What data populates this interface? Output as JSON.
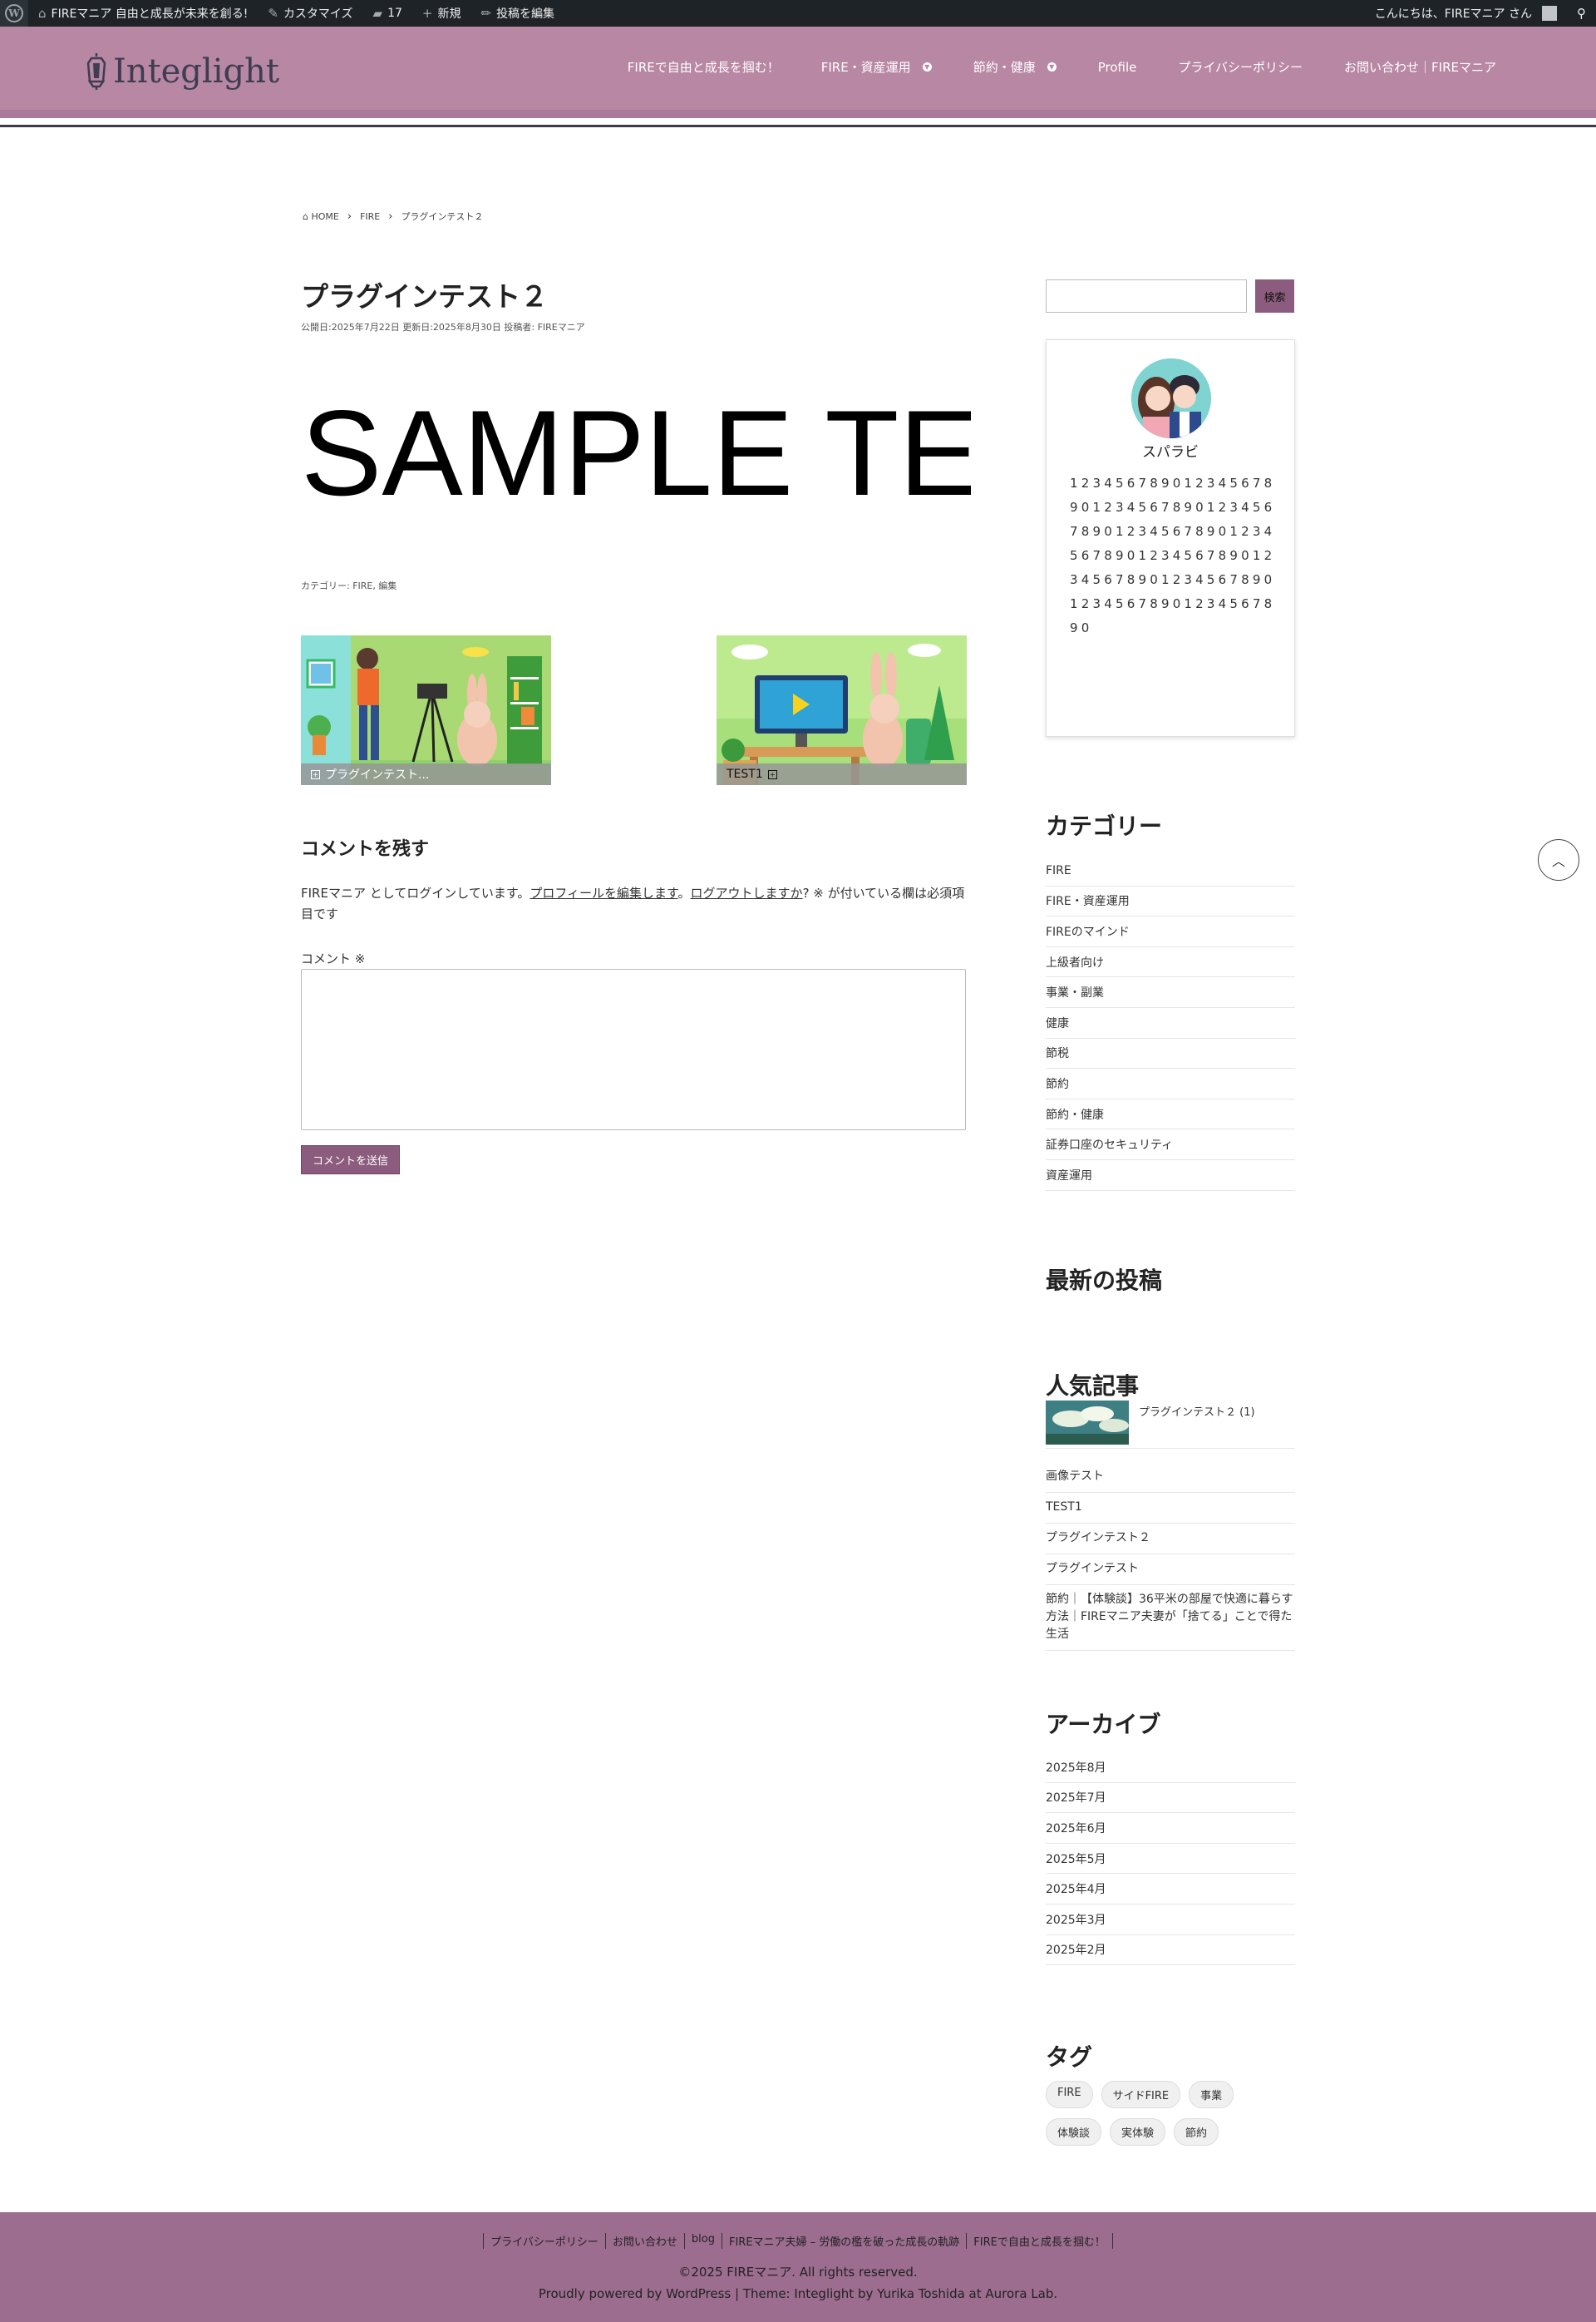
{
  "admin_bar": {
    "site_name": "FIREマニア 自由と成長が未来を創る!",
    "customize": "カスタマイズ",
    "comments_count": "17",
    "new": "新規",
    "edit_post": "投稿を編集",
    "greeting": "こんにちは、FIREマニア さん"
  },
  "header": {
    "logo_text": "Integlight",
    "nav": [
      {
        "label": "FIREで自由と成長を掴む！",
        "has_sub": false
      },
      {
        "label": "FIRE・資産運用",
        "has_sub": true
      },
      {
        "label": "節約・健康",
        "has_sub": true
      },
      {
        "label": "Profile",
        "has_sub": false
      },
      {
        "label": "プライバシーポリシー",
        "has_sub": false
      },
      {
        "label": "お問い合わせ｜FIREマニア",
        "has_sub": false
      }
    ]
  },
  "breadcrumb": {
    "home": "HOME",
    "cat": "FIRE",
    "current": "プラグインテスト２"
  },
  "post": {
    "title": "プラグインテスト２",
    "meta": "公開日:2025年7月22日 更新日:2025年8月30日 投稿者: FIREマニア",
    "sample_text": "SAMPLE TE",
    "categories": "カテゴリー: FIRE, 編集"
  },
  "related": [
    {
      "label": "プラグインテスト..."
    },
    {
      "label": "TEST1"
    }
  ],
  "comment": {
    "title": "コメントを残す",
    "logged_prefix": "FIREマニア としてログインしています。",
    "edit_profile": "プロフィールを編集します",
    "sep": "。",
    "logout": "ログアウトしますか",
    "logged_suffix": "? ※ が付いている欄は必須項目です",
    "label": "コメント ※",
    "submit": "コメントを送信"
  },
  "sidebar": {
    "search_button": "検索",
    "profile_name": "スパラビ",
    "profile_text": "12345678901234567890123456789012345678901234567890123456789012345678901234567890123456789012345678901234567890",
    "categories_title": "カテゴリー",
    "categories": [
      "FIRE",
      "FIRE・資産運用",
      "FIREのマインド",
      "上級者向け",
      "事業・副業",
      "健康",
      "節税",
      "節約",
      "節約・健康",
      "証券口座のセキュリティ",
      "資産運用"
    ],
    "recent_title": "最新の投稿",
    "popular_title": "人気記事",
    "popular_first": "プラグインテスト２ (1)",
    "popular": [
      "画像テスト",
      "TEST1",
      "プラグインテスト２",
      "プラグインテスト",
      "節約｜【体験談】36平米の部屋で快適に暮らす方法｜FIREマニア夫妻が「捨てる」ことで得た生活"
    ],
    "archive_title": "アーカイブ",
    "archives": [
      "2025年8月",
      "2025年7月",
      "2025年6月",
      "2025年5月",
      "2025年4月",
      "2025年3月",
      "2025年2月"
    ],
    "tags_title": "タグ",
    "tags": [
      "FIRE",
      "サイドFIRE",
      "事業",
      "体験談",
      "実体験",
      "節約"
    ]
  },
  "footer": {
    "nav": [
      "プライバシーポリシー",
      "お問い合わせ",
      "blog",
      "FIREマニア夫婦 – 労働の檻を破った成長の軌跡",
      "FIREで自由と成長を掴む！"
    ],
    "copyright": "©2025 FIREマニア. All rights reserved.",
    "powered": "Proudly powered by WordPress | Theme: Integlight by Yurika Toshida at Aurora Lab."
  },
  "colors": {
    "header": "#b887a3",
    "footer": "#9c6d8f",
    "accent": "#8c5c7e",
    "adminbar": "#1d2327"
  }
}
